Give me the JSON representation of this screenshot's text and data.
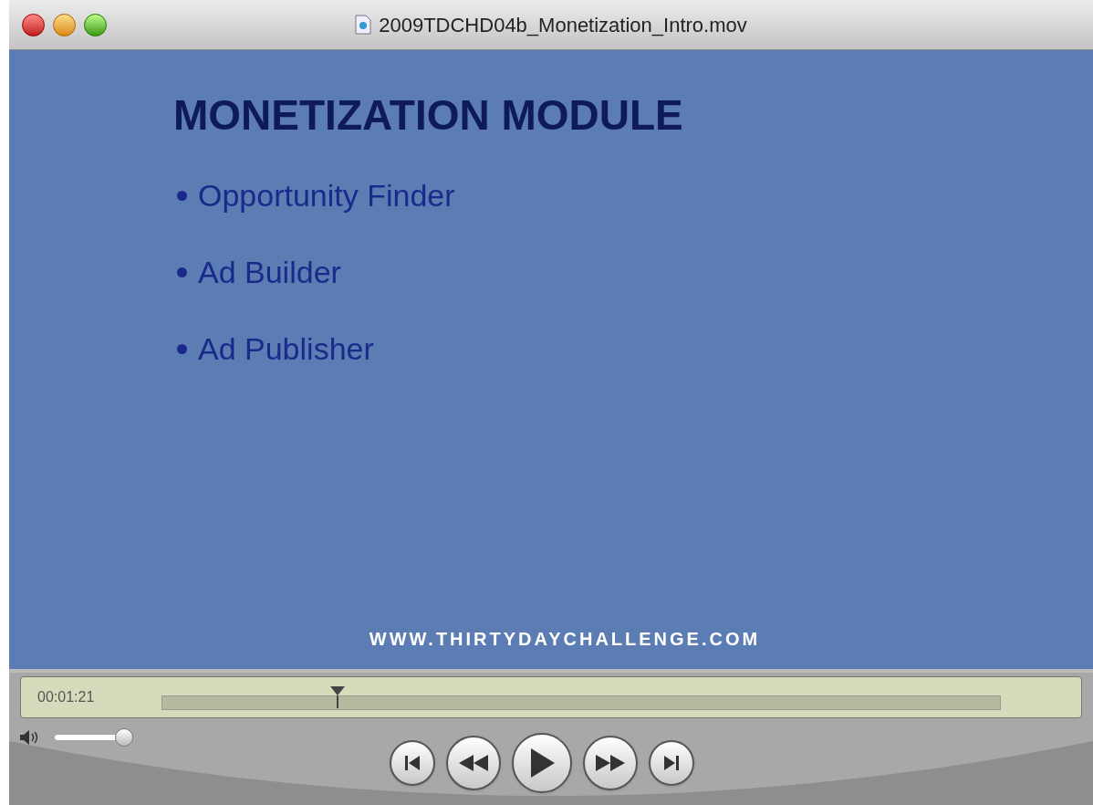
{
  "window": {
    "title": "2009TDCHD04b_Monetization_Intro.mov"
  },
  "slide": {
    "heading": "MONETIZATION MODULE",
    "bullets": [
      "Opportunity Finder",
      "Ad Builder",
      "Ad Publisher"
    ],
    "footer": "WWW.THIRTYDAYCHALLENGE.COM"
  },
  "timeline": {
    "time": "00:01:21",
    "level": 0.21
  },
  "volume": {
    "level": 1
  }
}
